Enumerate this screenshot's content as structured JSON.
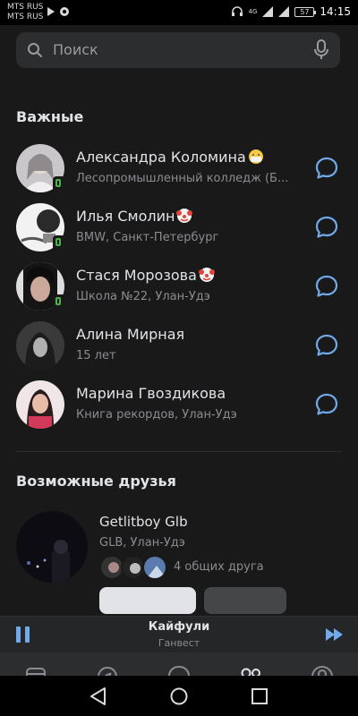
{
  "status_bar": {
    "carrier_1": "MTS RUS",
    "carrier_2": "MTS RUS",
    "network": "4G",
    "battery": "57",
    "time": "14:15"
  },
  "search": {
    "placeholder": "Поиск"
  },
  "important": {
    "title": "Важные",
    "friends": [
      {
        "name": "Александра Коломина",
        "subtitle": "Лесопромышленный колледж (Б...",
        "emoji": "mask-face",
        "online": true
      },
      {
        "name": "Илья Смолин",
        "subtitle": "BMW, Санкт-Петербург",
        "emoji": "clown-face",
        "online": true
      },
      {
        "name": "Стася Морозова",
        "subtitle": "Школа №22, Улан-Удэ",
        "emoji": "clown-face",
        "online": true
      },
      {
        "name": "Алина Мирная",
        "subtitle": "15 лет",
        "emoji": "",
        "online": false
      },
      {
        "name": "Марина Гвоздикова",
        "subtitle": "Книга рекордов, Улан-Удэ",
        "emoji": "",
        "online": false
      }
    ]
  },
  "suggestions": {
    "title": "Возможные друзья",
    "items": [
      {
        "name": "Getlitboy Glb",
        "subtitle": "GLB, Улан-Удэ",
        "mutual": "4 общих друга"
      }
    ]
  },
  "player": {
    "title": "Кайфули",
    "artist": "Ганвест"
  },
  "tabs": [
    "news-tab",
    "discover-tab",
    "messages-tab",
    "friends-tab",
    "profile-tab"
  ],
  "active_tab": "friends-tab",
  "colors": {
    "accent": "#71aaeb",
    "online": "#4bb34b",
    "background": "#19191a"
  }
}
